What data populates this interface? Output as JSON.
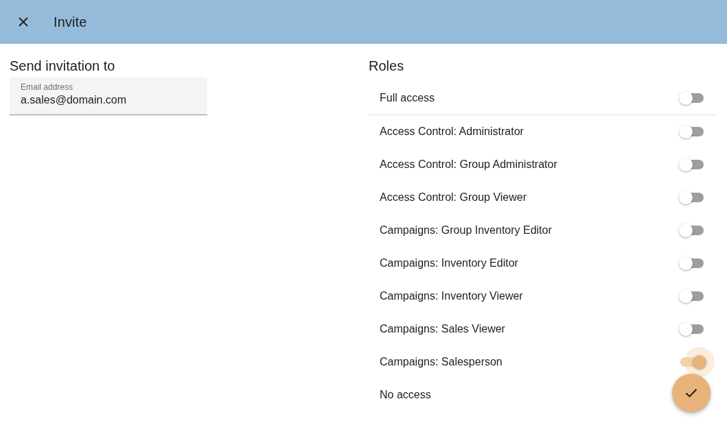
{
  "header": {
    "title": "Invite"
  },
  "invitation": {
    "heading": "Send invitation to",
    "email_field": {
      "label": "Email address",
      "value": "a.sales@domain.com"
    }
  },
  "roles": {
    "heading": "Roles",
    "items": [
      {
        "kind": "all",
        "label": "Full access",
        "on": false,
        "focused": false
      },
      {
        "kind": "single",
        "label": "Access Control: Administrator",
        "on": false,
        "focused": false
      },
      {
        "kind": "single",
        "label": "Access Control: Group Administrator",
        "on": false,
        "focused": false
      },
      {
        "kind": "single",
        "label": "Access Control: Group Viewer",
        "on": false,
        "focused": false
      },
      {
        "kind": "single",
        "label": "Campaigns: Group Inventory Editor",
        "on": false,
        "focused": false
      },
      {
        "kind": "single",
        "label": "Campaigns: Inventory Editor",
        "on": false,
        "focused": false
      },
      {
        "kind": "single",
        "label": "Campaigns: Inventory Viewer",
        "on": false,
        "focused": false
      },
      {
        "kind": "single",
        "label": "Campaigns: Sales Viewer",
        "on": false,
        "focused": false
      },
      {
        "kind": "single",
        "label": "Campaigns: Salesperson",
        "on": true,
        "focused": true
      },
      {
        "kind": "single",
        "label": "No access"
      }
    ]
  }
}
